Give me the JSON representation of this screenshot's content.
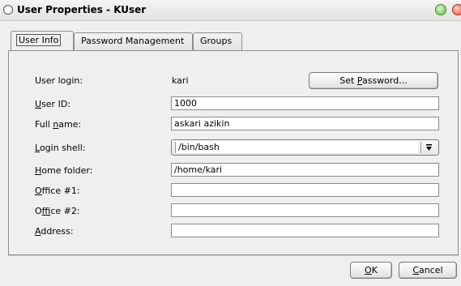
{
  "window": {
    "title": "User Properties - KUser"
  },
  "tabs": [
    {
      "label": "User Info"
    },
    {
      "label": "Password Management"
    },
    {
      "label": "Groups"
    }
  ],
  "form": {
    "user_login": {
      "label": "User login:",
      "value": "kari"
    },
    "set_password_button": {
      "pre": "Set ",
      "mnemonic": "P",
      "post": "assword..."
    },
    "user_id": {
      "mnemonic": "U",
      "rest": "ser ID:",
      "value": "1000"
    },
    "full_name": {
      "pre": "Full ",
      "mnemonic": "n",
      "post": "ame:",
      "value": "askari azikin"
    },
    "login_shell": {
      "mnemonic": "L",
      "rest": "ogin shell:",
      "value": "/bin/bash"
    },
    "home_folder": {
      "mnemonic": "H",
      "rest": "ome folder:",
      "value": "/home/kari"
    },
    "office1": {
      "mnemonic": "O",
      "rest": "ffice #1:",
      "value": ""
    },
    "office2": {
      "pre": "O",
      "mnemonic": "f",
      "post": "fice #2:",
      "value": ""
    },
    "address": {
      "mnemonic": "A",
      "rest": "ddress:",
      "value": ""
    }
  },
  "buttons": {
    "ok": {
      "mnemonic": "O",
      "rest": "K"
    },
    "cancel": {
      "mnemonic": "C",
      "rest": "ancel"
    }
  }
}
